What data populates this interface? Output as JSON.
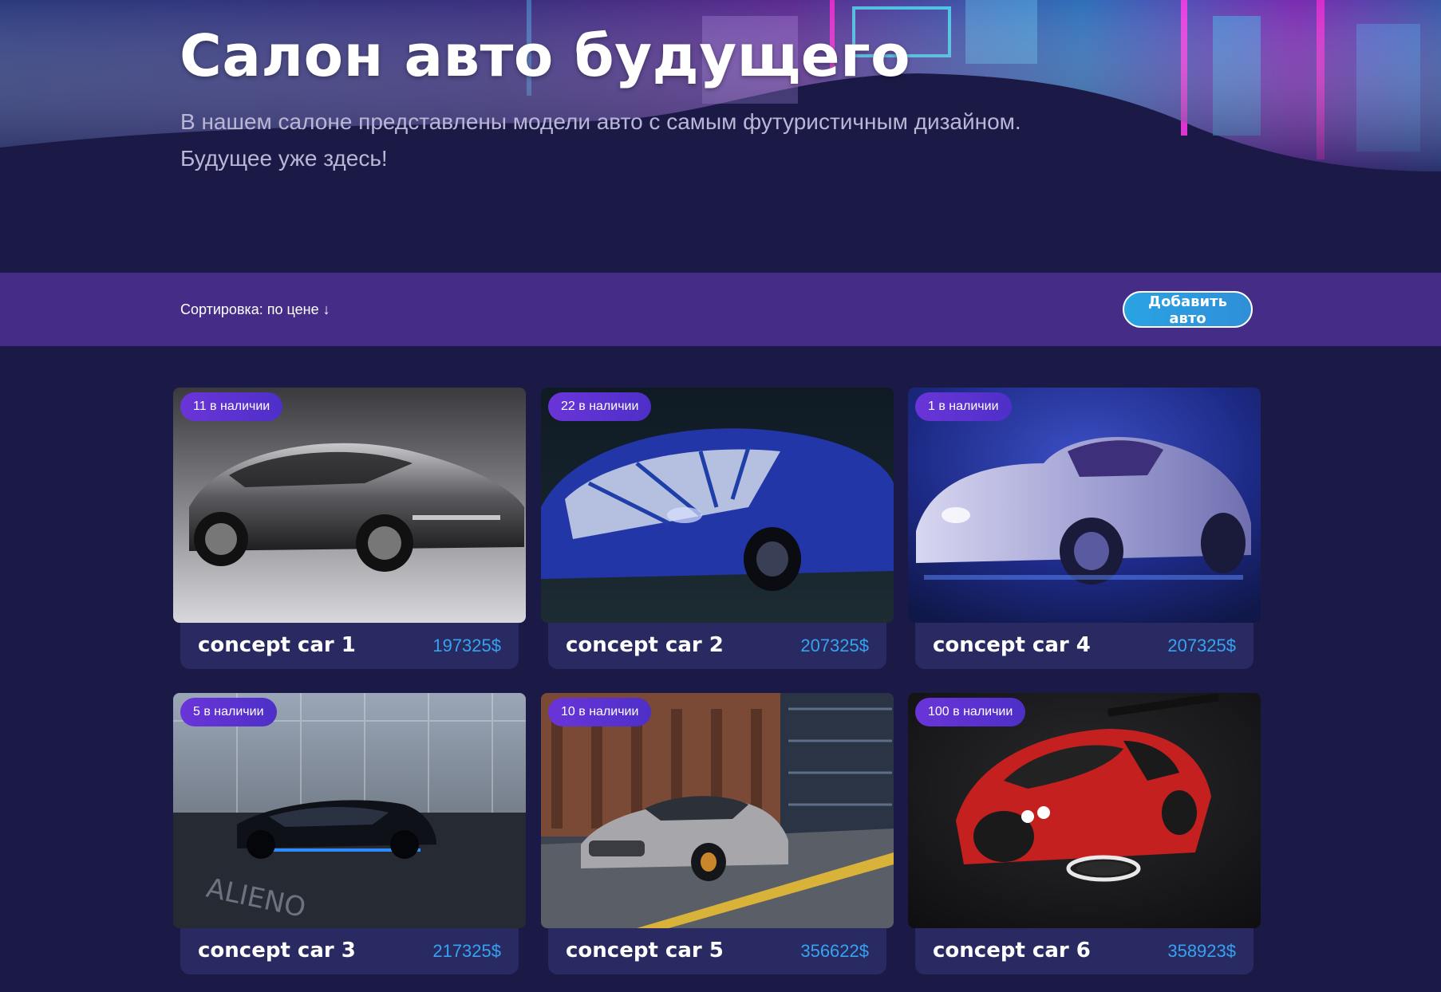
{
  "hero": {
    "title": "Салон авто будущего",
    "subtitle": "В нашем салоне представлены модели авто с самым футуристичным дизайном. Будущее уже здесь!"
  },
  "toolbar": {
    "sort_label": "Сортировка: по цене ↓",
    "add_button_label": "Добавить авто"
  },
  "colors": {
    "page_background": "#1b1a47",
    "toolbar_background": "#452c87",
    "card_info_background": "#2a2a62",
    "price": "#36a3f0",
    "stock_badge": "#5a31d0",
    "add_button": "#2aa3e3"
  },
  "cars": [
    {
      "name": "concept car 1",
      "price": "197325$",
      "stock": "11 в наличии",
      "image": "silver-concept-car-photo"
    },
    {
      "name": "concept car 2",
      "price": "207325$",
      "stock": "22 в наличии",
      "image": "blue-pattern-supercar-photo"
    },
    {
      "name": "concept car 4",
      "price": "207325$",
      "stock": "1 в наличии",
      "image": "neon-purple-coupe-photo"
    },
    {
      "name": "concept car 3",
      "price": "217325$",
      "stock": "5 в наличии",
      "image": "black-hypercar-garage-photo"
    },
    {
      "name": "concept car 5",
      "price": "356622$",
      "stock": "10 в наличии",
      "image": "silver-gt-street-photo"
    },
    {
      "name": "concept car 6",
      "price": "358923$",
      "stock": "100 в наличии",
      "image": "red-hover-car-photo"
    }
  ]
}
